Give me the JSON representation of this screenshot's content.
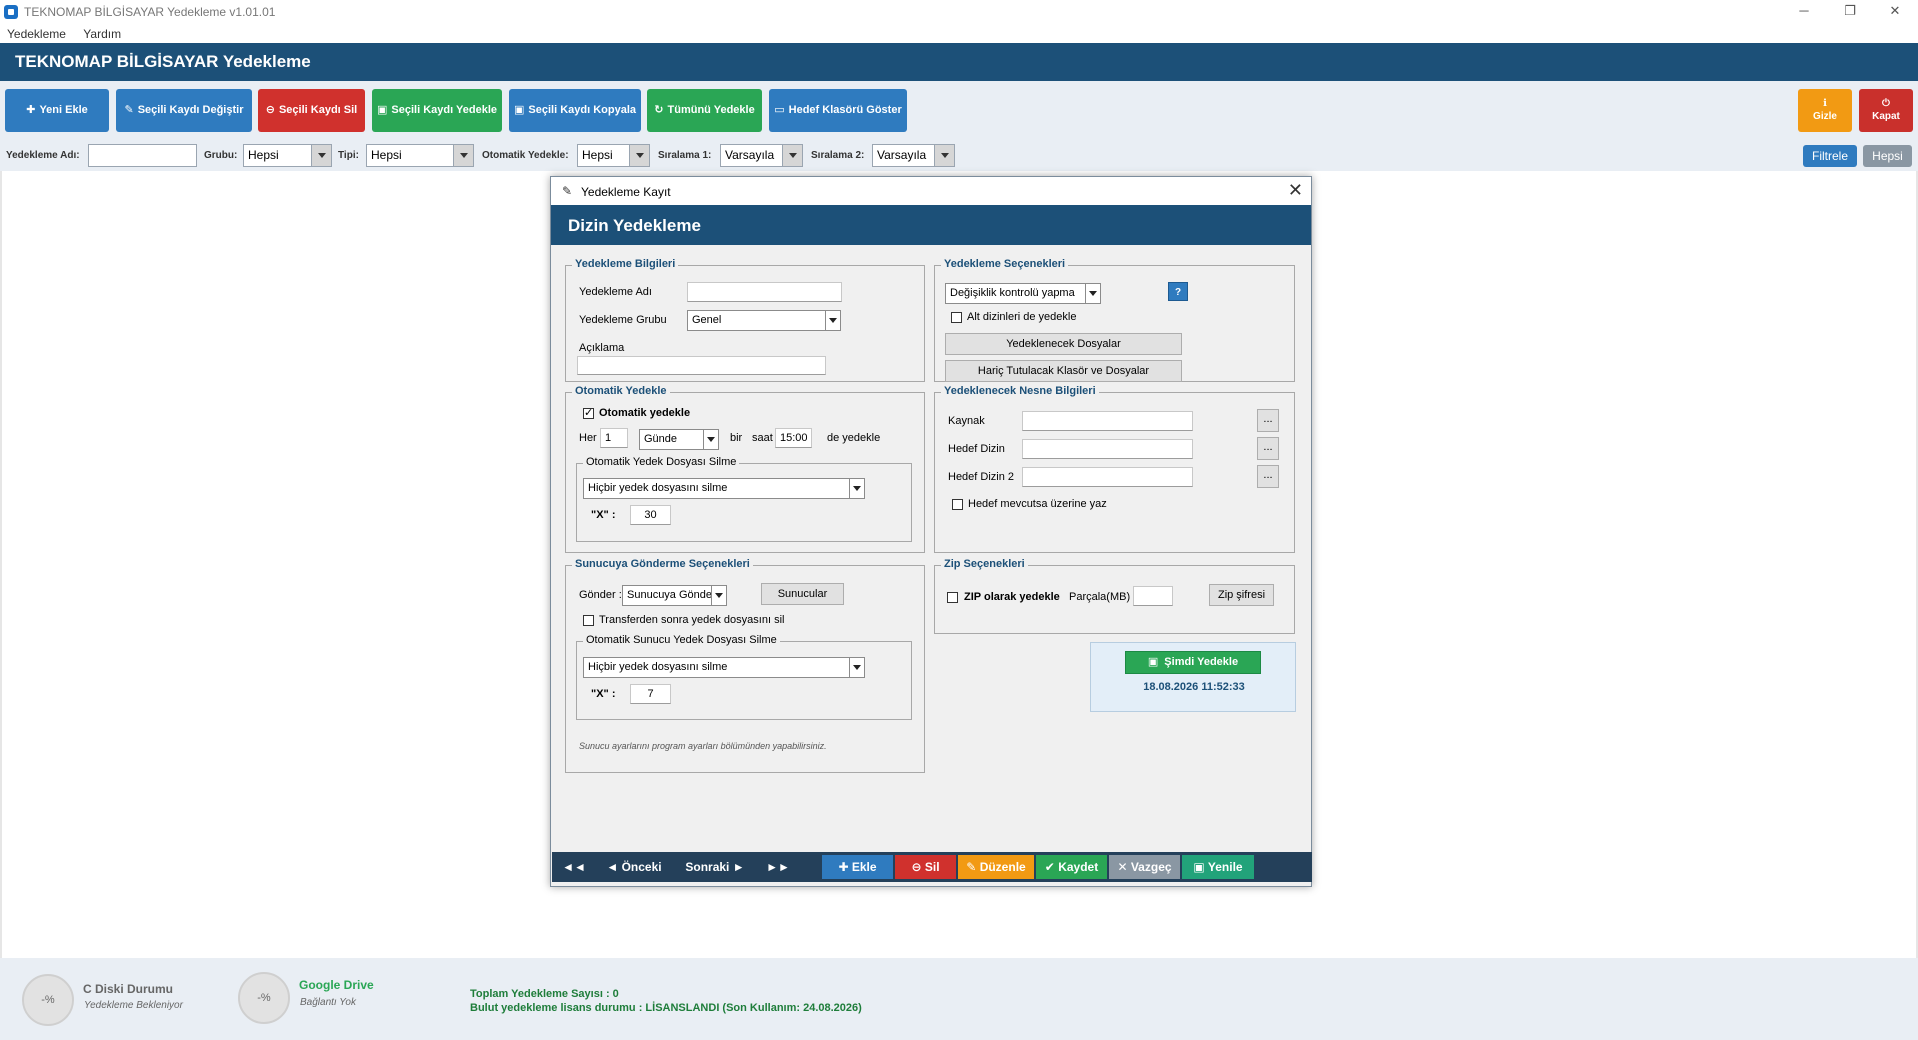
{
  "window": {
    "title": "TEKNOMAP BİLGİSAYAR Yedekleme v1.01.01",
    "minimize": "─",
    "maximize": "❐",
    "close": "✕"
  },
  "menu": [
    "Yedekleme",
    "Yardım"
  ],
  "header": {
    "title": "TEKNOMAP BİLGİSAYAR Yedekleme"
  },
  "toolbar": {
    "new": "Yeni Ekle",
    "edit": "Seçili Kaydı Değiştir",
    "delete": "Seçili Kaydı Sil",
    "backup_selected": "Seçili Kaydı Yedekle",
    "copy": "Seçili Kaydı Kopyala",
    "backup_all": "Tümünü Yedekle",
    "show_target": "Hedef Klasörü Göster",
    "hide": "Gizle",
    "close": "Kapat"
  },
  "filters": {
    "name_label": "Yedekleme Adı:",
    "name_value": "",
    "group_label": "Grubu:",
    "group_value": "Hepsi",
    "type_label": "Tipi:",
    "type_value": "Hepsi",
    "auto_label": "Otomatik Yedekle:",
    "auto_value": "Hepsi",
    "sort1_label": "Sıralama 1:",
    "sort1_value": "Varsayıla",
    "sort2_label": "Sıralama 2:",
    "sort2_value": "Varsayıla",
    "filter_button": "Filtrele",
    "all_button": "Hepsi"
  },
  "status": {
    "disk_percent": "-%",
    "disk_title": "C Diski Durumu",
    "disk_sub": "Yedekleme Bekleniyor",
    "gdrive_percent": "-%",
    "gdrive_title": "Google Drive",
    "gdrive_sub": "Bağlantı Yok",
    "total": "Toplam Yedekleme Sayısı : 0",
    "license": "Bulut yedekleme lisans durumu : LİSANSLANDI (Son Kullanım: 24.08.2026)"
  },
  "dialog": {
    "title": "Yedekleme Kayıt",
    "close": "✕",
    "heading": "Dizin Yedekleme",
    "info": {
      "title": "Yedekleme Bilgileri",
      "name_label": "Yedekleme Adı",
      "name_value": "",
      "group_label": "Yedekleme Grubu",
      "group_value": "Genel",
      "desc_label": "Açıklama",
      "desc_value": ""
    },
    "options": {
      "title": "Yedekleme Seçenekleri",
      "change_control": "Değişiklik kontrolü yapma",
      "help": "?",
      "subdirs_label": "Alt dizinleri de yedekle",
      "subdirs_checked": false,
      "files_button": "Yedeklenecek Dosyalar",
      "excluded_button": "Hariç Tutulacak Klasör ve Dosyalar"
    },
    "auto": {
      "title": "Otomatik Yedekle",
      "enabled_label": "Otomatik yedekle",
      "enabled": true,
      "every_label": "Her",
      "every_value": "1",
      "unit_value": "Günde",
      "once_label": "bir",
      "time_label": "saat",
      "time_value": "15:00",
      "suffix": "de yedekle",
      "delete_title": "Otomatik Yedek Dosyası Silme",
      "delete_value": "Hiçbir yedek dosyasını silme",
      "x_label": "\"X\" :",
      "x_value": "30"
    },
    "object": {
      "title": "Yedeklenecek Nesne Bilgileri",
      "source_label": "Kaynak",
      "source_value": "",
      "target_label": "Hedef Dizin",
      "target_value": "",
      "target2_label": "Hedef Dizin 2",
      "target2_value": "",
      "browse": "...",
      "overwrite_label": "Hedef mevcutsa üzerine yaz",
      "overwrite_checked": false
    },
    "server": {
      "title": "Sunucuya Gönderme Seçenekleri",
      "send_label": "Gönder :",
      "send_value": "Sunucuya Gönderme",
      "servers_button": "Sunucular",
      "transfer_label": "Transferden sonra yedek dosyasını sil",
      "transfer_checked": false,
      "delete_title": "Otomatik Sunucu Yedek Dosyası Silme",
      "delete_value": "Hiçbir yedek dosyasını silme",
      "x_label": "\"X\" :",
      "x_value": "7",
      "note": "Sunucu ayarlarını program ayarları bölümünden yapabilirsiniz."
    },
    "zip": {
      "title": "Zip Seçenekleri",
      "zip_label": "ZIP olarak yedekle",
      "zip_checked": false,
      "parts_label": "Parçala(MB)",
      "parts_value": "",
      "password_button": "Zip şifresi"
    },
    "backup_now": {
      "button": "Şimdi Yedekle",
      "datetime": "18.08.2026 11:52:33"
    },
    "nav": {
      "first": "◄◄",
      "prev": "◄ Önceki",
      "next": "Sonraki ►",
      "last": "►►",
      "add": "Ekle",
      "delete": "Sil",
      "edit": "Düzenle",
      "save": "Kaydet",
      "cancel": "Vazgeç",
      "refresh": "Yenile"
    }
  },
  "colors": {
    "header": "#1c5078",
    "blue": "#2f7bbf",
    "red": "#d0312d",
    "green": "#2aa655",
    "orange": "#f29a13",
    "darkred": "#c9302c"
  }
}
